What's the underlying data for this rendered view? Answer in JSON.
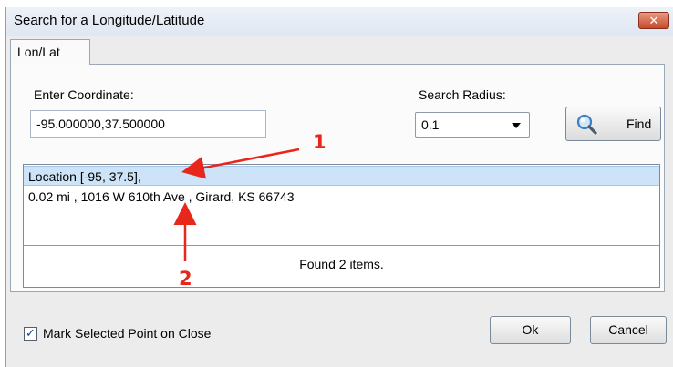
{
  "window": {
    "title": "Search for a Longitude/Latitude",
    "close_glyph": "✕"
  },
  "tabs": [
    {
      "label": "Lon/Lat",
      "selected": true
    }
  ],
  "form": {
    "coordinate_label": "Enter Coordinate:",
    "coordinate_value": "-95.000000,37.500000",
    "radius_label": "Search Radius:",
    "radius_value": "0.1",
    "find_label": "Find",
    "find_icon": "magnifier-icon"
  },
  "results": {
    "rows": [
      {
        "text": "Location [-95, 37.5],",
        "selected": true
      },
      {
        "text": "0.02 mi , 1016 W 610th Ave , Girard, KS 66743",
        "selected": false
      }
    ],
    "status": "Found 2 items."
  },
  "footer": {
    "mark_point_label": "Mark Selected Point on Close",
    "mark_point_checked": true,
    "ok_label": "Ok",
    "cancel_label": "Cancel"
  },
  "annotations": [
    {
      "label": "1"
    },
    {
      "label": "2"
    }
  ],
  "colors": {
    "annotation": "#e8261c",
    "selection": "#cde3f7",
    "close_button": "#c64a2b"
  }
}
